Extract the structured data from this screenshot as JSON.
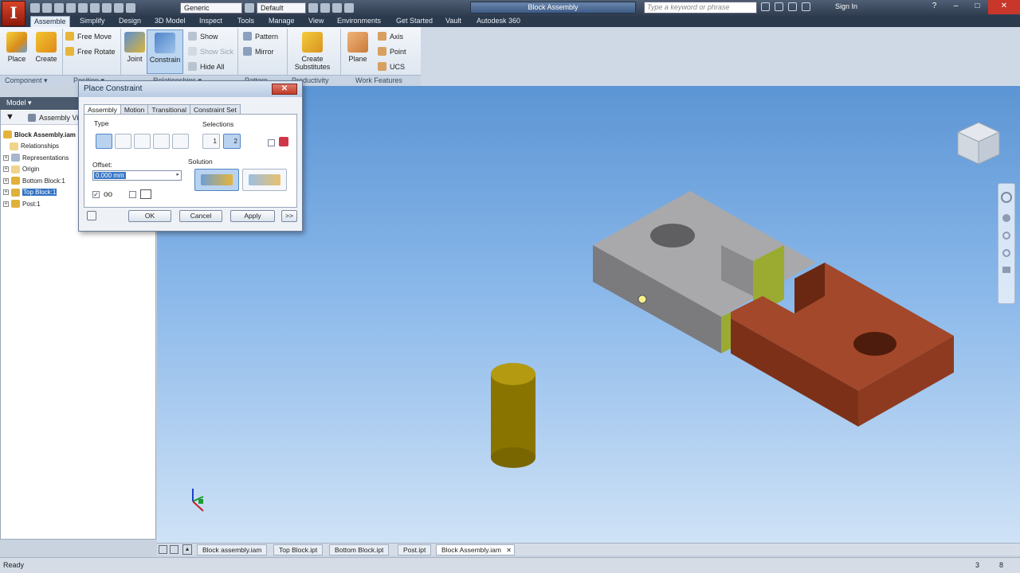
{
  "titlebar": {
    "app_letter": "I",
    "material_combo": "Generic",
    "appearance_combo": "Default",
    "document_title": "Block Assembly",
    "search_placeholder": "Type a keyword or phrase",
    "sign_in": "Sign In"
  },
  "ribbon_tabs": [
    {
      "label": "Assemble",
      "active": true
    },
    {
      "label": "Simplify"
    },
    {
      "label": "Design"
    },
    {
      "label": "3D Model"
    },
    {
      "label": "Inspect"
    },
    {
      "label": "Tools"
    },
    {
      "label": "Manage"
    },
    {
      "label": "View"
    },
    {
      "label": "Environments"
    },
    {
      "label": "Get Started"
    },
    {
      "label": "Vault"
    },
    {
      "label": "Autodesk 360"
    }
  ],
  "ribbon": {
    "place": "Place",
    "create": "Create",
    "free_move": "Free Move",
    "free_rotate": "Free Rotate",
    "joint": "Joint",
    "constrain": "Constrain",
    "show": "Show",
    "show_sick": "Show Sick",
    "hide_all": "Hide All",
    "pattern": "Pattern",
    "mirror": "Mirror",
    "create_substitutes_1": "Create",
    "create_substitutes_2": "Substitutes",
    "plane": "Plane",
    "axis": "Axis",
    "point": "Point",
    "ucs": "UCS",
    "panels": [
      "Component ▾",
      "Position ▾",
      "Relationships ▾",
      "Pattern",
      "Productivity",
      "Work Features"
    ]
  },
  "browser": {
    "header": "Model ▾",
    "view_label": "Assembly View",
    "tree": [
      {
        "label": "Block Assembly.iam",
        "bold": true,
        "expander": ""
      },
      {
        "label": "Relationships",
        "expander": ""
      },
      {
        "label": "Representations",
        "expander": "+"
      },
      {
        "label": "Origin",
        "expander": "+"
      },
      {
        "label": "Bottom Block:1",
        "expander": "+"
      },
      {
        "label": "Top Block:1",
        "expander": "+",
        "selected": true
      },
      {
        "label": "Post:1",
        "expander": "+"
      }
    ]
  },
  "dialog": {
    "title": "Place Constraint",
    "close": "✕",
    "tabs": [
      "Assembly",
      "Motion",
      "Transitional",
      "Constraint Set"
    ],
    "type_label": "Type",
    "selections_label": "Selections",
    "sel1": "1",
    "sel2": "2",
    "offset_label": "Offset:",
    "offset_value": "0.000 mm",
    "solution_label": "Solution",
    "ok": "OK",
    "cancel": "Cancel",
    "apply": "Apply",
    "more": ">>"
  },
  "doc_tabs": [
    {
      "label": "Block assembly.iam"
    },
    {
      "label": "Top Block.ipt"
    },
    {
      "label": "Bottom Block.ipt"
    },
    {
      "label": "Post.ipt"
    },
    {
      "label": "Block Assembly.iam",
      "active": true
    }
  ],
  "status": {
    "left": "Ready",
    "count1": "3",
    "count2": "8"
  },
  "colors": {
    "viewport_top": "#5c95d4",
    "viewport_bottom": "#cfe2f6",
    "top_block": "#a3482a",
    "bottom_block": "#8e8e8e",
    "constraint_face": "#9bab32",
    "post": "#8a7400"
  }
}
